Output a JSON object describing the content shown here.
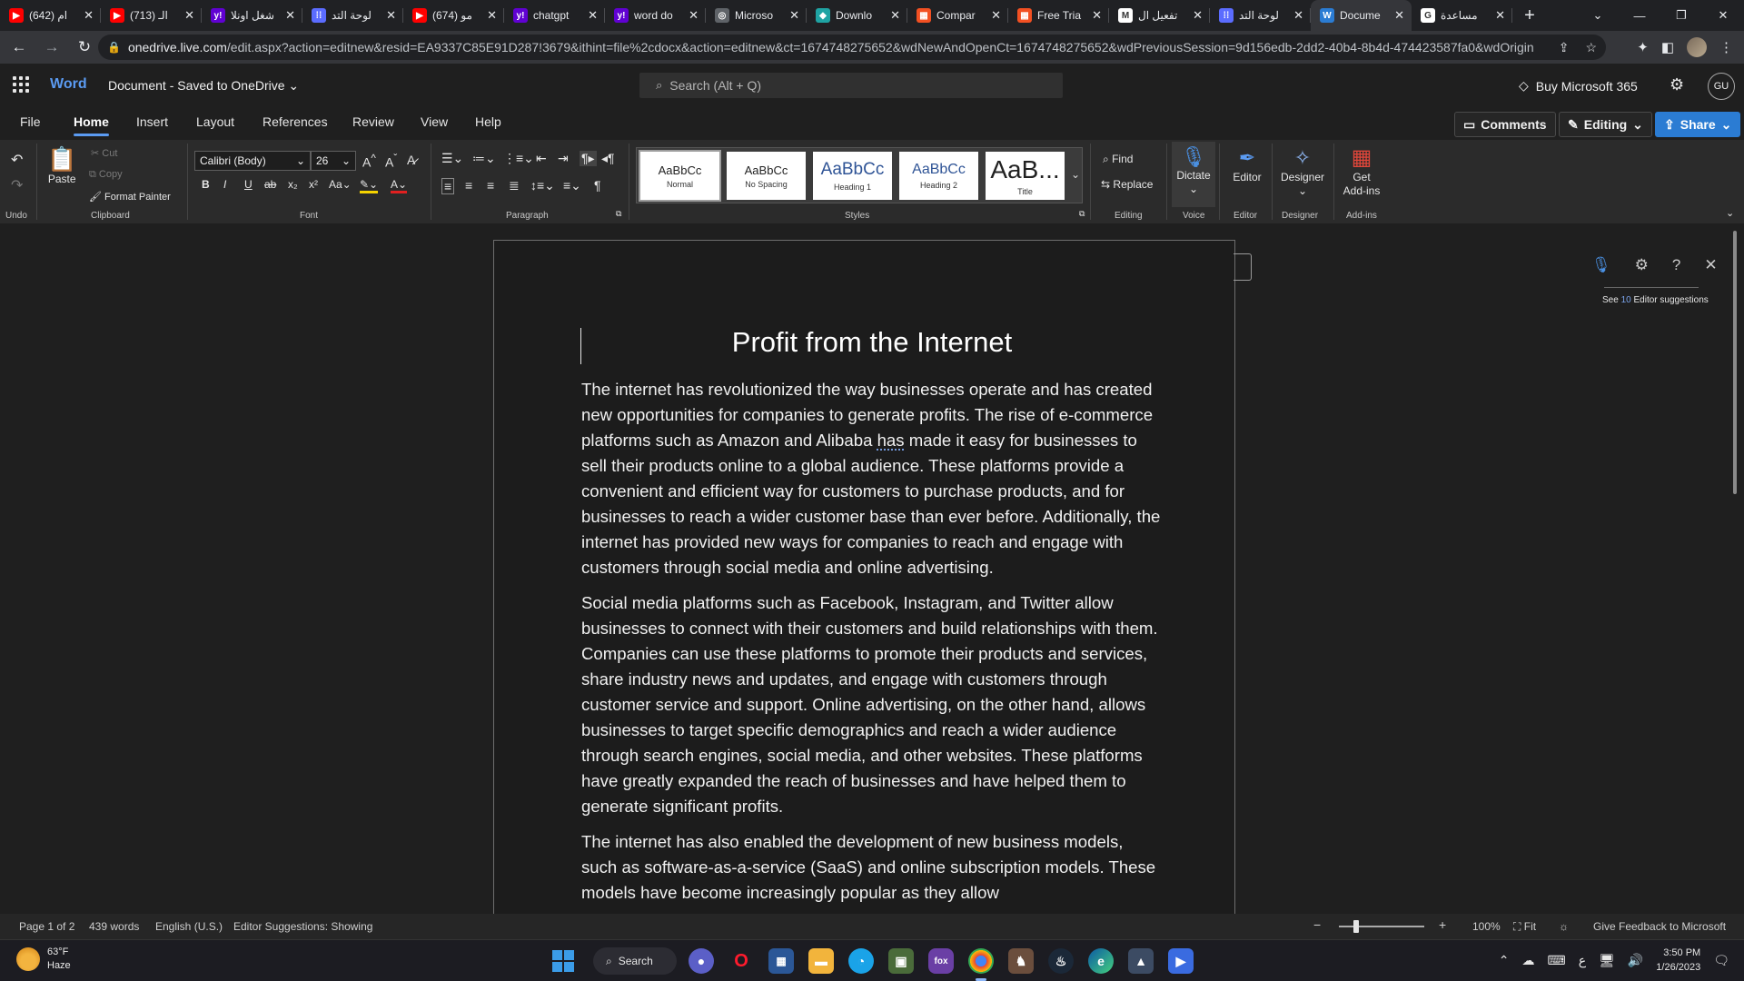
{
  "browser": {
    "tabs": [
      {
        "title": "(642) ام",
        "icon": "youtube-icon",
        "color": "#ff0000",
        "glyph": "▶"
      },
      {
        "title": "(713) الـ",
        "icon": "youtube-icon",
        "color": "#ff0000",
        "glyph": "▶"
      },
      {
        "title": "شغل اونلا",
        "icon": "yahoo-icon",
        "color": "#6001d2",
        "glyph": "y!"
      },
      {
        "title": "لوحة التد",
        "icon": "site-icon",
        "color": "#5b6cff",
        "glyph": "⁞⁞"
      },
      {
        "title": "(674) مو",
        "icon": "youtube-icon",
        "color": "#ff0000",
        "glyph": "▶"
      },
      {
        "title": "chatgpt",
        "icon": "yahoo-icon",
        "color": "#6001d2",
        "glyph": "y!"
      },
      {
        "title": "word do",
        "icon": "yahoo-icon",
        "color": "#6001d2",
        "glyph": "y!"
      },
      {
        "title": "Microso",
        "icon": "globe-icon",
        "color": "#5f6368",
        "glyph": "◎"
      },
      {
        "title": "Downlo",
        "icon": "download-site-icon",
        "color": "#1fa3a3",
        "glyph": "◆"
      },
      {
        "title": "Compar",
        "icon": "microsoft-icon",
        "color": "#f25022",
        "glyph": "▦"
      },
      {
        "title": "Free Tria",
        "icon": "microsoft-icon",
        "color": "#f25022",
        "glyph": "▦"
      },
      {
        "title": "تفعيل ال",
        "icon": "gmail-icon",
        "color": "#ffffff",
        "glyph": "M"
      },
      {
        "title": "لوحة التد",
        "icon": "site-icon",
        "color": "#5b6cff",
        "glyph": "⁞⁞"
      },
      {
        "title": "Docume",
        "icon": "word-icon",
        "color": "#2b7cd3",
        "glyph": "W",
        "active": true
      },
      {
        "title": "مساعدة",
        "icon": "google-icon",
        "color": "#ffffff",
        "glyph": "G"
      }
    ],
    "url_domain": "onedrive.live.com",
    "url_path": "/edit.aspx?action=editnew&resid=EA9337C85E91D287!3679&ithint=file%2cdocx&action=editnew&ct=1674748275652&wdNewAndOpenCt=1674748275652&wdPreviousSession=9d156edb-2dd2-40b4-8b4d-474423587fa0&wdOrigin..."
  },
  "word": {
    "app_name": "Word",
    "doc_title": "Document - Saved to OneDrive",
    "search_placeholder": "Search (Alt + Q)",
    "buy_label": "Buy Microsoft 365",
    "avatar_initials": "GU"
  },
  "menu": {
    "tabs": [
      "File",
      "Home",
      "Insert",
      "Layout",
      "References",
      "Review",
      "View",
      "Help"
    ],
    "active_tab": "Home",
    "comments_label": "Comments",
    "editing_label": "Editing",
    "share_label": "Share"
  },
  "ribbon": {
    "groups": {
      "undo": "Undo",
      "clipboard": "Clipboard",
      "font": "Font",
      "paragraph": "Paragraph",
      "styles": "Styles",
      "editing": "Editing",
      "voice": "Voice",
      "editor": "Editor",
      "designer": "Designer",
      "addins": "Add-ins"
    },
    "paste_label": "Paste",
    "cut_label": "Cut",
    "copy_label": "Copy",
    "format_painter_label": "Format Painter",
    "font_name": "Calibri (Body)",
    "font_size": "26",
    "styles": [
      {
        "preview": "AaBbCc",
        "name": "Normal"
      },
      {
        "preview": "AaBbCc",
        "name": "No Spacing"
      },
      {
        "preview": "AaBbCc",
        "name": "Heading 1"
      },
      {
        "preview": "AaBbCc",
        "name": "Heading 2"
      },
      {
        "preview": "AaB...",
        "name": "Title"
      }
    ],
    "find_label": "Find",
    "replace_label": "Replace",
    "dictate_label": "Dictate",
    "editor_label": "Editor",
    "designer_label": "Designer",
    "addins_label_1": "Get",
    "addins_label_2": "Add-ins"
  },
  "document": {
    "title": "Profit from the Internet",
    "p1_a": "The internet has revolutionized the way businesses operate and has created new opportunities for companies to generate profits. The rise of e-commerce platforms such as Amazon and Alibaba ",
    "p1_flag": "has",
    "p1_b": " made it easy for businesses to sell their products online to a global audience. These platforms provide a convenient and efficient way for customers to purchase products, and for businesses to reach a wider customer base than ever before. Additionally, the internet has provided new ways for companies to reach and engage with customers through social media and online advertising.",
    "p2": "Social media platforms such as Facebook, Instagram, and Twitter allow businesses to connect with their customers and build relationships with them. Companies can use these platforms to promote their products and services, share industry news and updates, and engage with customers through customer service and support. Online advertising, on the other hand, allows businesses to target specific demographics and reach a wider audience through search engines, social media, and other websites. These platforms have greatly expanded the reach of businesses and have helped them to generate significant profits.",
    "p3": "The internet has also enabled the development of new business models, such as software-as-a-service (SaaS) and online subscription models. These models have become increasingly popular as they allow"
  },
  "dictate_panel": {
    "see_label": "See",
    "count": "10",
    "suggestions_label": "Editor suggestions"
  },
  "status": {
    "page": "Page 1 of 2",
    "words": "439 words",
    "language": "English (U.S.)",
    "editor": "Editor Suggestions: Showing",
    "zoom": "100%",
    "fit": "Fit",
    "feedback": "Give Feedback to Microsoft"
  },
  "taskbar": {
    "temp": "63°F",
    "condition": "Haze",
    "search_label": "Search",
    "time": "3:50 PM",
    "date": "1/26/2023",
    "lang": "ع"
  }
}
